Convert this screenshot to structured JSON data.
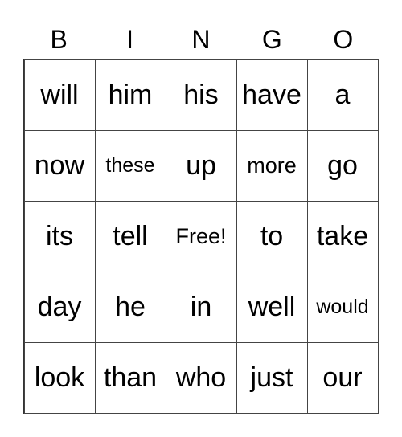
{
  "header": [
    "B",
    "I",
    "N",
    "G",
    "O"
  ],
  "cells": [
    [
      "will",
      "him",
      "his",
      "have",
      "a"
    ],
    [
      "now",
      "these",
      "up",
      "more",
      "go"
    ],
    [
      "its",
      "tell",
      "Free!",
      "to",
      "take"
    ],
    [
      "day",
      "he",
      "in",
      "well",
      "would"
    ],
    [
      "look",
      "than",
      "who",
      "just",
      "our"
    ]
  ]
}
